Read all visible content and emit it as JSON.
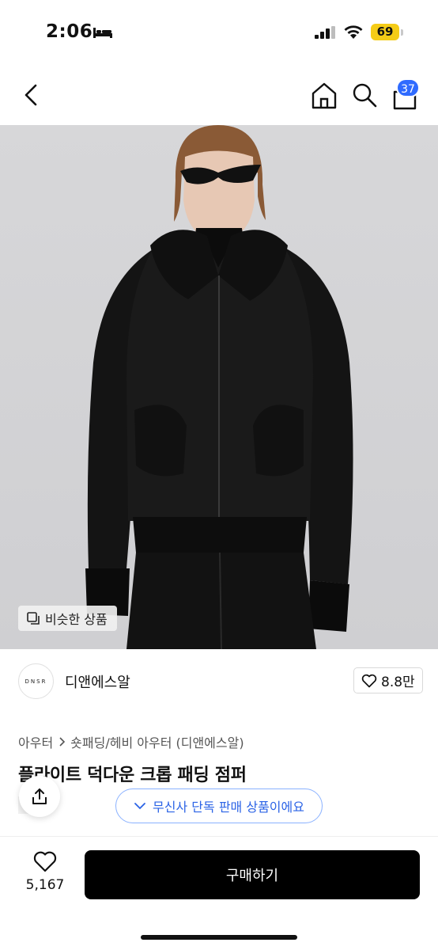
{
  "status_bar": {
    "time": "2:06",
    "battery": "69"
  },
  "nav": {
    "cart_count": "37"
  },
  "hero": {
    "similar_label": "비슷한 상품"
  },
  "brand": {
    "logo_text": "DNSR",
    "name": "디앤에스알",
    "likes": "8.8만"
  },
  "product": {
    "category": "아우터",
    "subcategory": "숏패딩/헤비 아우터 (디앤에스알)",
    "title": "플라이트 덕다운 크롭 패딩 점퍼",
    "exclusive_tag": "단독",
    "exclusive_notice": "무신사 단독 판매 상품이에요"
  },
  "bottom_bar": {
    "wish_count": "5,167",
    "buy_label": "구매하기"
  },
  "colors": {
    "accent_blue": "#2f6bff",
    "battery": "#f5cc17",
    "buy_button": "#000000"
  }
}
